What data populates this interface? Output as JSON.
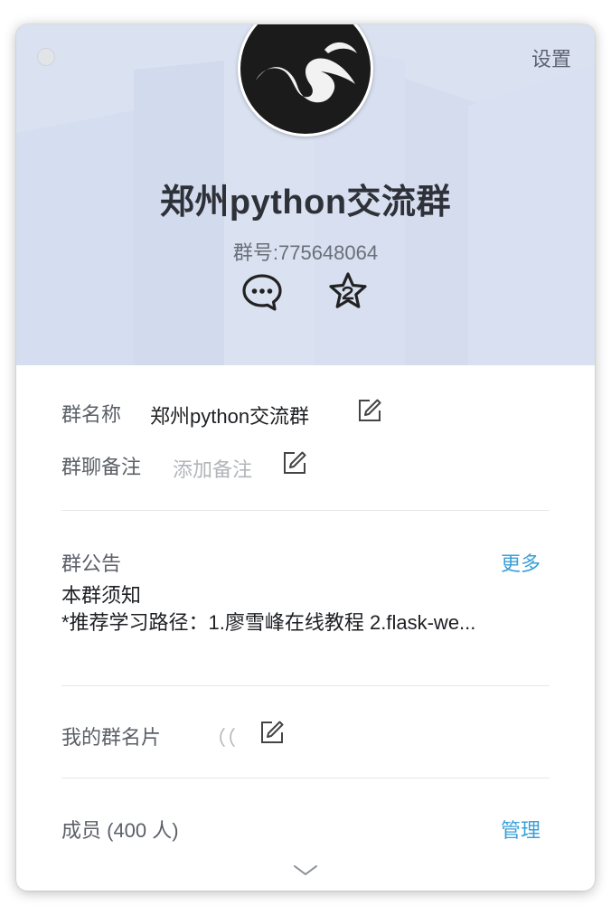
{
  "window": {
    "settings_label": "设置"
  },
  "header": {
    "avatar": "group-avatar-icon",
    "title": "郑州python交流群",
    "number_label": "群号:775648064",
    "actions": [
      {
        "icon": "chat-bubble-icon"
      },
      {
        "icon": "star-icon"
      }
    ]
  },
  "info": {
    "name_label": "群名称",
    "name_value": "郑州python交流群",
    "remark_label": "群聊备注",
    "remark_placeholder": "添加备注"
  },
  "notice": {
    "label": "群公告",
    "more_label": "更多",
    "line1": "本群须知",
    "line2": "*推荐学习路径：1.廖雪峰在线教程 2.flask-we..."
  },
  "card_name": {
    "label": "我的群名片",
    "value": "（（"
  },
  "members": {
    "label": "成员 (400 人)",
    "manage_label": "管理",
    "expand_icon": "chevron-down-icon"
  },
  "colors": {
    "header_bg": "#d9e0f0",
    "link": "#3aa0d8",
    "title": "#2e3138"
  }
}
